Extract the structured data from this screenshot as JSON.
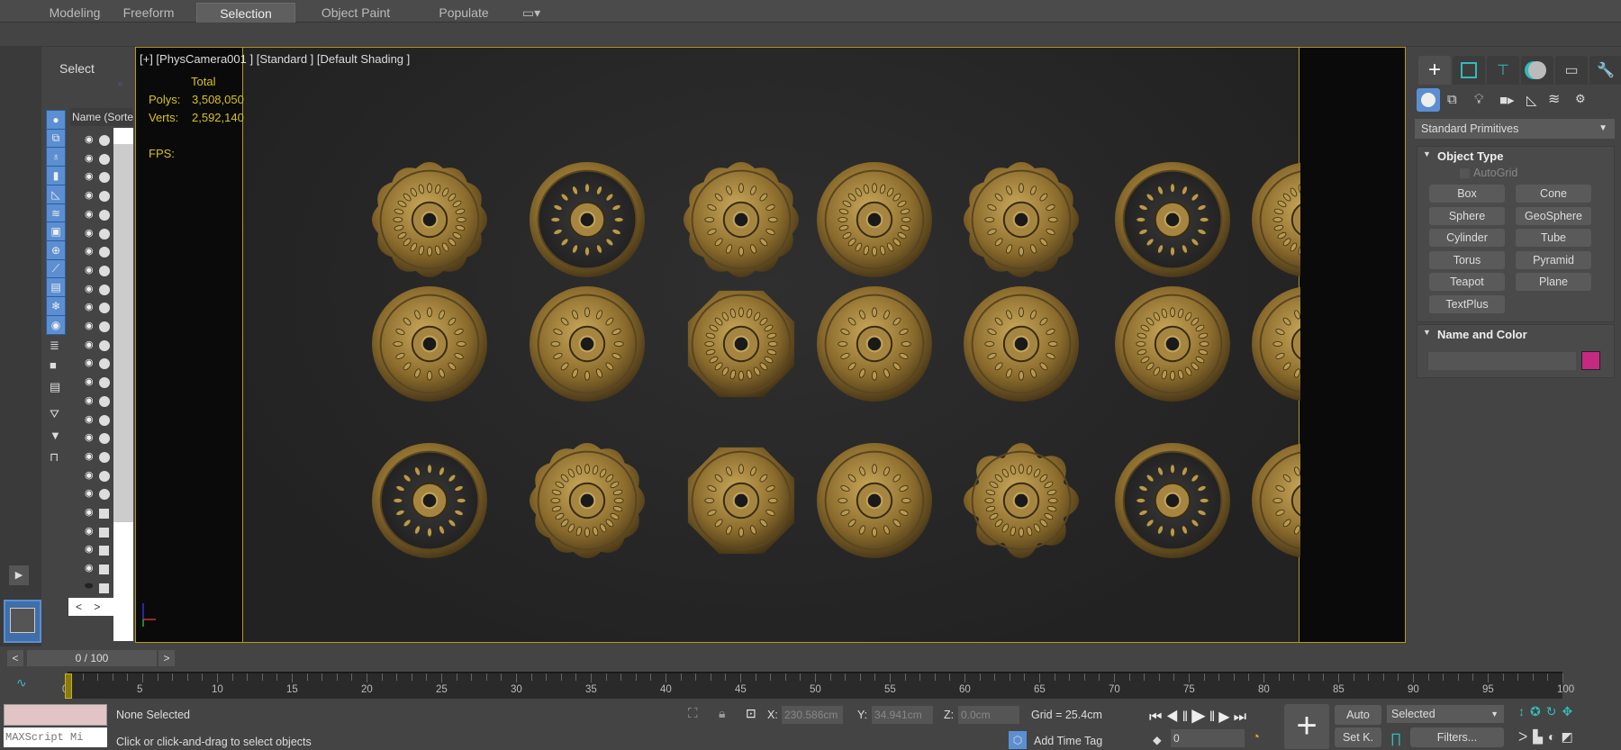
{
  "ribbon": {
    "tabs": [
      "Modeling",
      "Freeform",
      "Selection",
      "Object Paint",
      "Populate"
    ],
    "active": "Selection"
  },
  "explorer": {
    "title": "Select",
    "column_header": "Name (Sorte"
  },
  "viewport": {
    "label": "[+] [PhysCamera001 ] [Standard ] [Default Shading ]",
    "stats": {
      "header": "Total",
      "polys_label": "Polys:",
      "polys": "3,508,050",
      "verts_label": "Verts:",
      "verts": "2,592,140",
      "fps_label": "FPS:"
    }
  },
  "command_panel": {
    "dropdown": "Standard Primitives",
    "object_type": {
      "title": "Object Type",
      "autogrid": "AutoGrid",
      "buttons": [
        "Box",
        "Cone",
        "Sphere",
        "GeoSphere",
        "Cylinder",
        "Tube",
        "Torus",
        "Pyramid",
        "Teapot",
        "Plane",
        "TextPlus"
      ]
    },
    "name_color": {
      "title": "Name and Color",
      "name_value": "",
      "color": "#c42a82"
    }
  },
  "timeline": {
    "frame": "0 / 100",
    "prev": "<",
    "next": ">",
    "ticks": [
      "0",
      "5",
      "10",
      "15",
      "20",
      "25",
      "30",
      "35",
      "40",
      "45",
      "50",
      "55",
      "60",
      "65",
      "70",
      "75",
      "80",
      "85",
      "90",
      "95",
      "100"
    ]
  },
  "status": {
    "maxscript": "MAXScript Mi",
    "selection": "None Selected",
    "prompt": "Click or click-and-drag to select objects",
    "x_label": "X:",
    "x": "230.586cm",
    "y_label": "Y:",
    "y": "34.941cm",
    "z_label": "Z:",
    "z": "0.0cm",
    "grid": "Grid = 25.4cm",
    "add_time_tag": "Add Time Tag",
    "frame_value": "0",
    "auto": "Auto",
    "set_key": "Set K.",
    "key_filter": "Selected",
    "filters": "Filters..."
  },
  "colors": {
    "accent": "#5b8fd1",
    "viewport_border": "#b59a1e",
    "stats_text": "#d8c21a",
    "object_color": "#c42a82"
  }
}
